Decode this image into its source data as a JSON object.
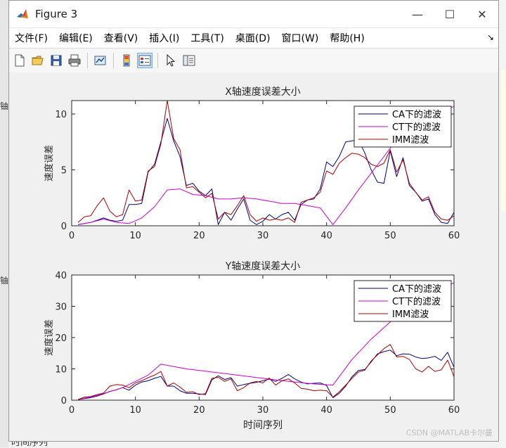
{
  "window": {
    "title": "Figure 3",
    "controls": {
      "minimize": "—",
      "maximize": "☐",
      "close": "✕"
    }
  },
  "menu": [
    "文件(F)",
    "编辑(E)",
    "查看(V)",
    "插入(I)",
    "工具(T)",
    "桌面(D)",
    "窗口(W)",
    "帮助(H)"
  ],
  "menu_arrow": "↘",
  "toolbar": [
    "new-figure-icon",
    "open-file-icon",
    "save-icon",
    "print-icon",
    "link-plot-icon",
    "colorbar-icon",
    "legend-icon",
    "pointer-icon",
    "property-inspector-icon"
  ],
  "background_fragments": {
    "left_1": "铀",
    "left_2": "铀",
    "bottom": "时间序列"
  },
  "watermark": "CSDN @MATLAB卡尔曼",
  "colors": {
    "CA": "#00007a",
    "CT": "#cc00cc",
    "IMM": "#aa0000"
  },
  "chart_data": [
    {
      "type": "line",
      "title": "X轴速度误差大小",
      "xlabel": "",
      "ylabel": "速度误差",
      "xlim": [
        0,
        60
      ],
      "ylim": [
        0,
        11.2
      ],
      "xticks": [
        "0",
        "10",
        "20",
        "30",
        "40",
        "50",
        "60"
      ],
      "yticks": [
        "0",
        "5",
        "10"
      ],
      "ytick_values": [
        0,
        5,
        10
      ],
      "legend_position": "top-right",
      "series": [
        {
          "name": "CA下的滤波",
          "x": [
            1,
            2,
            3,
            4,
            5,
            6,
            7,
            8,
            9,
            10,
            11,
            12,
            13,
            14,
            15,
            16,
            17,
            18,
            19,
            20,
            21,
            22,
            23,
            24,
            25,
            26,
            27,
            28,
            29,
            30,
            31,
            32,
            33,
            34,
            35,
            36,
            37,
            38,
            39,
            40,
            41,
            42,
            43,
            44,
            45,
            46,
            47,
            48,
            49,
            50,
            51,
            52,
            53,
            54,
            55,
            56,
            57,
            58,
            59,
            60
          ],
          "values": [
            0.1,
            0.2,
            0.3,
            0.5,
            0.7,
            0.5,
            0.4,
            0.5,
            1.9,
            1.9,
            2.0,
            4.8,
            5.5,
            7.5,
            9.6,
            7.6,
            6.2,
            3.6,
            3.8,
            3.1,
            2.7,
            3.3,
            0.1,
            1.2,
            0.5,
            1.5,
            2.4,
            0.5,
            0.1,
            0.4,
            1.0,
            0.6,
            1.0,
            1.2,
            0.5,
            1.9,
            2.3,
            2.4,
            3.3,
            5.7,
            5.3,
            6.2,
            7.5,
            7.6,
            7.7,
            6.5,
            5.0,
            3.9,
            3.8,
            6.7,
            4.4,
            6.1,
            3.6,
            3.0,
            2.2,
            2.4,
            1.0,
            0.3,
            0.2,
            1.2
          ]
        },
        {
          "name": "CT下的滤波",
          "x": [
            1,
            3,
            5,
            7,
            9,
            11,
            13,
            15,
            17,
            19,
            21,
            23,
            25,
            27,
            29,
            31,
            33,
            35,
            37,
            39,
            41,
            43,
            45,
            47,
            49,
            51,
            53,
            55,
            57,
            59,
            60
          ],
          "values": [
            0.1,
            0.3,
            0.6,
            0.3,
            0.2,
            0.7,
            1.7,
            3.2,
            3.3,
            2.8,
            2.7,
            2.4,
            2.4,
            2.5,
            2.4,
            2.2,
            2.0,
            2.0,
            1.8,
            1.6,
            0.1,
            1.6,
            3.2,
            4.7,
            6.2,
            7.7,
            8.6,
            9.2,
            9.7,
            10.4,
            10.7
          ]
        },
        {
          "name": "IMM滤波",
          "x": [
            1,
            2,
            3,
            4,
            5,
            6,
            7,
            8,
            9,
            10,
            11,
            12,
            13,
            14,
            15,
            16,
            17,
            18,
            19,
            20,
            21,
            22,
            23,
            24,
            25,
            26,
            27,
            28,
            29,
            30,
            31,
            32,
            33,
            34,
            35,
            36,
            37,
            38,
            39,
            40,
            41,
            42,
            43,
            44,
            45,
            46,
            47,
            48,
            49,
            50,
            51,
            52,
            53,
            54,
            55,
            56,
            57,
            58,
            59,
            60
          ],
          "values": [
            0.3,
            0.8,
            0.9,
            1.8,
            2.5,
            1.3,
            0.8,
            1.0,
            3.2,
            2.2,
            2.3,
            4.9,
            5.3,
            7.3,
            11.2,
            7.8,
            6.8,
            3.4,
            3.5,
            3.0,
            2.5,
            2.9,
            0.6,
            1.2,
            1.0,
            1.8,
            2.7,
            1.0,
            0.4,
            0.7,
            0.5,
            0.6,
            0.5,
            0.7,
            0.3,
            2.1,
            2.3,
            2.5,
            3.0,
            4.9,
            4.6,
            5.6,
            6.1,
            6.5,
            6.4,
            6.1,
            5.5,
            5.3,
            5.6,
            6.8,
            4.8,
            5.9,
            3.8,
            3.0,
            2.3,
            2.6,
            1.2,
            0.6,
            0.5,
            0.9
          ]
        }
      ]
    },
    {
      "type": "line",
      "title": "Y轴速度误差大小",
      "xlabel": "时间序列",
      "ylabel": "速度误差",
      "xlim": [
        0,
        60
      ],
      "ylim": [
        0,
        40
      ],
      "xticks": [
        "0",
        "10",
        "20",
        "30",
        "40",
        "50",
        "60"
      ],
      "yticks": [
        "0",
        "10",
        "20",
        "30",
        "40"
      ],
      "ytick_values": [
        0,
        10,
        20,
        30,
        40
      ],
      "legend_position": "top-right",
      "series": [
        {
          "name": "CA下的滤波",
          "x": [
            1,
            2,
            3,
            4,
            5,
            6,
            7,
            8,
            9,
            10,
            11,
            12,
            13,
            14,
            15,
            16,
            17,
            18,
            19,
            20,
            21,
            22,
            23,
            24,
            25,
            26,
            27,
            28,
            29,
            30,
            31,
            32,
            33,
            34,
            35,
            36,
            37,
            38,
            39,
            40,
            41,
            42,
            43,
            44,
            45,
            46,
            47,
            48,
            49,
            50,
            51,
            52,
            53,
            54,
            55,
            56,
            57,
            58,
            59,
            60
          ],
          "values": [
            0.2,
            0.5,
            0.8,
            1.3,
            2.0,
            2.8,
            3.3,
            4.0,
            3.2,
            4.8,
            5.8,
            6.2,
            7.0,
            7.6,
            4.5,
            4.5,
            3.0,
            2.2,
            2.2,
            2.0,
            1.8,
            6.5,
            7.8,
            6.6,
            7.2,
            4.5,
            5.0,
            5.4,
            5.7,
            6.2,
            6.7,
            6.0,
            7.0,
            8.2,
            6.8,
            5.8,
            5.2,
            5.4,
            5.5,
            4.7,
            0.8,
            2.2,
            4.5,
            7.5,
            9.5,
            9.8,
            12.2,
            14.8,
            15.5,
            16.0,
            14.2,
            14.8,
            14.7,
            13.8,
            13.3,
            13.5,
            14.0,
            12.7,
            15.3,
            10.5
          ]
        },
        {
          "name": "CT下的滤波",
          "x": [
            1,
            4,
            8,
            12,
            14,
            18,
            22,
            26,
            30,
            34,
            38,
            41,
            44,
            47,
            50,
            53,
            56,
            58,
            60
          ],
          "values": [
            0.2,
            1.5,
            4.0,
            8.0,
            11.5,
            10.0,
            9.0,
            8.0,
            7.0,
            6.0,
            5.2,
            4.8,
            13.0,
            19.5,
            25.0,
            29.0,
            33.0,
            35.5,
            37.5
          ]
        },
        {
          "name": "IMM滤波",
          "x": [
            1,
            2,
            3,
            4,
            5,
            6,
            7,
            8,
            9,
            10,
            11,
            12,
            13,
            14,
            15,
            16,
            17,
            18,
            19,
            20,
            21,
            22,
            23,
            24,
            25,
            26,
            27,
            28,
            29,
            30,
            31,
            32,
            33,
            34,
            35,
            36,
            37,
            38,
            39,
            40,
            41,
            42,
            43,
            44,
            45,
            46,
            47,
            48,
            49,
            50,
            51,
            52,
            53,
            54,
            55,
            56,
            57,
            58,
            59,
            60
          ],
          "values": [
            0.2,
            1.0,
            1.2,
            1.8,
            2.3,
            4.5,
            5.0,
            4.8,
            4.0,
            5.5,
            6.2,
            7.2,
            8.0,
            9.2,
            4.5,
            5.5,
            4.2,
            2.5,
            2.7,
            1.8,
            2.1,
            7.0,
            7.3,
            6.0,
            6.8,
            3.0,
            4.0,
            5.5,
            6.0,
            5.5,
            7.1,
            4.8,
            6.2,
            6.8,
            5.5,
            3.8,
            3.5,
            3.0,
            3.2,
            3.0,
            1.0,
            2.7,
            4.8,
            7.0,
            9.0,
            9.6,
            12.5,
            14.5,
            16.5,
            17.8,
            13.8,
            14.0,
            13.0,
            10.0,
            9.0,
            10.8,
            9.2,
            9.7,
            12.8,
            7.5
          ]
        }
      ]
    }
  ]
}
